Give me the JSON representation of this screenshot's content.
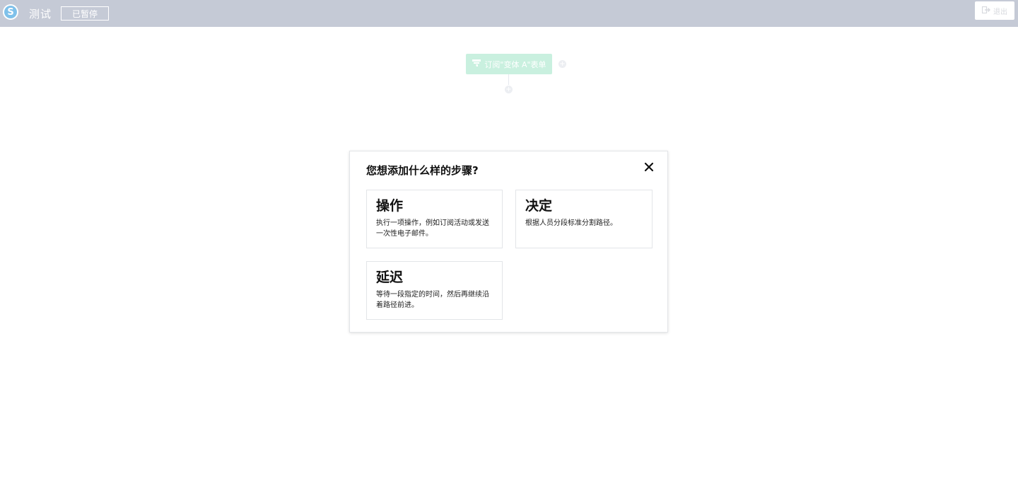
{
  "header": {
    "logo_letter": "S",
    "title": "测试",
    "status": "已暂停",
    "exit_label": "退出"
  },
  "canvas": {
    "trigger_label": "订阅\"变体 A\"表单"
  },
  "modal": {
    "title": "您想添加什么样的步骤?",
    "options": [
      {
        "title": "操作",
        "description": "执行一项操作，例如订阅活动或发送一次性电子邮件。"
      },
      {
        "title": "决定",
        "description": "根据人员分段标准分割路径。"
      },
      {
        "title": "延迟",
        "description": "等待一段指定的时间，然后再继续沿着路径前进。"
      }
    ]
  },
  "colors": {
    "topbar": "#c5cad6",
    "logo": "#7fc1ea",
    "trigger_node": "#c9f0df"
  }
}
